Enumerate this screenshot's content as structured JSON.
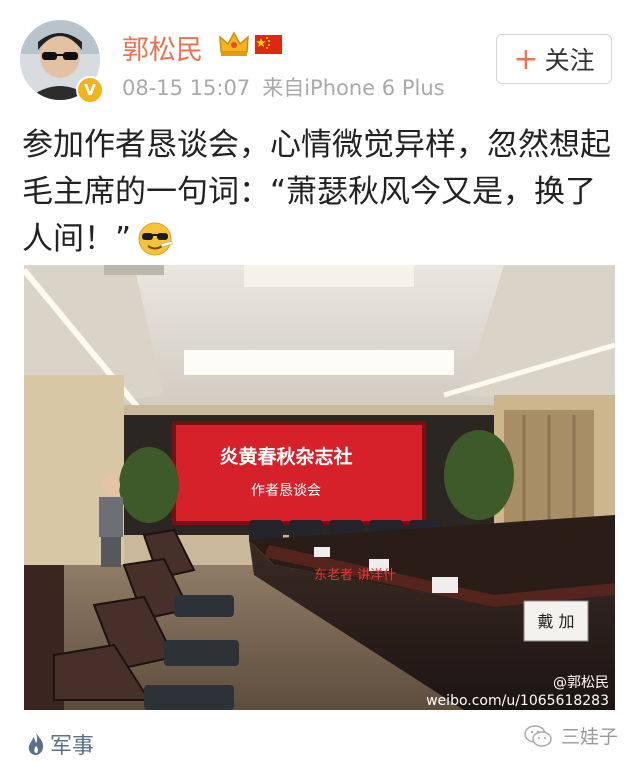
{
  "post": {
    "user_name": "郭松民",
    "timestamp": "08-15 15:07",
    "source": "来自iPhone 6 Plus",
    "follow_label": "关注",
    "text": "参加作者恳谈会，心情微觉异样，忽然想起毛主席的一句词：“萧瑟秋风今又是，换了人间！”",
    "tag": "军事"
  },
  "photo": {
    "screen_line1": "炎黄春秋杂志社",
    "screen_line2": "作者恳谈会",
    "name_card": "戴 加",
    "table_text": "东老者  讲洋什",
    "watermark_handle": "@郭松民",
    "watermark_url": "weibo.com/u/1065618283"
  },
  "footer": {
    "wechat_name": "三娃子"
  },
  "colors": {
    "name": "#eb7350",
    "meta": "#a9a9a9",
    "tag": "#5d6f88",
    "screen": "#d6212a",
    "badge": "#f3b31d"
  },
  "icons": [
    "verified-badge-icon",
    "crown-icon",
    "china-flag-icon",
    "plus-icon",
    "cool-emoji",
    "flame-icon",
    "wechat-icon"
  ]
}
